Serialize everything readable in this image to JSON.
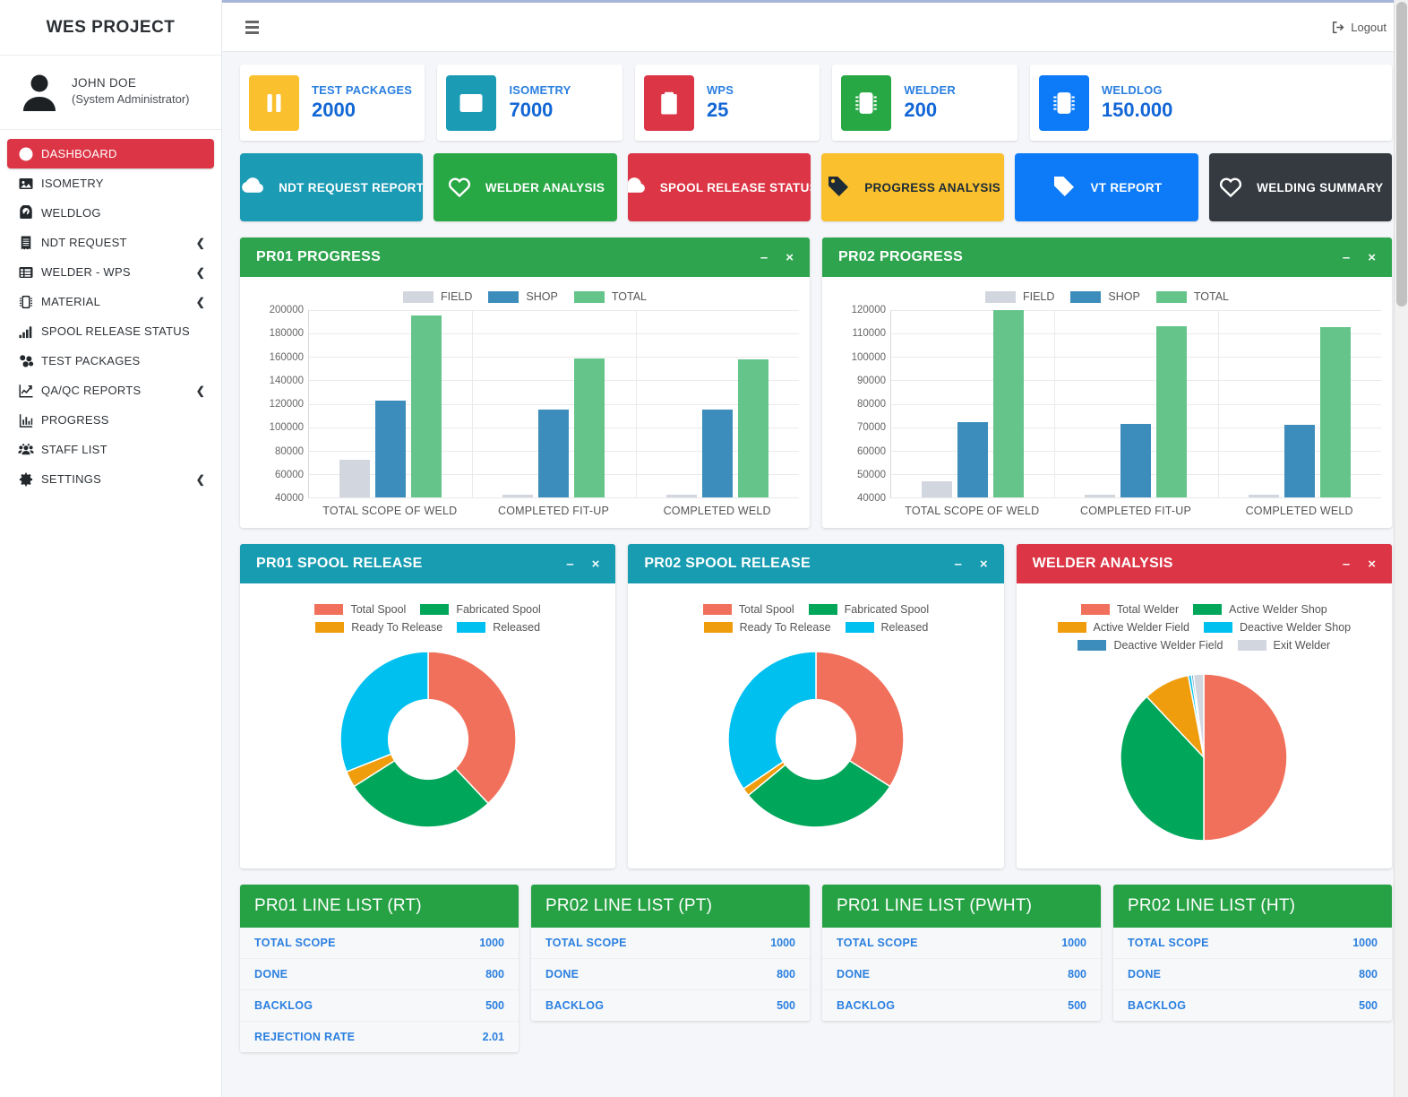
{
  "sidebar": {
    "brand": "WES PROJECT",
    "user": {
      "name": "JOHN DOE",
      "role": "(System Administrator)",
      "avatar_icon": "user-avatar-icon"
    },
    "items": [
      {
        "label": "DASHBOARD",
        "icon": "dashboard-gauge-icon",
        "active": true,
        "chevron": ""
      },
      {
        "label": "ISOMETRY",
        "icon": "image-icon",
        "active": false,
        "chevron": ""
      },
      {
        "label": "WELDLOG",
        "icon": "compass-icon",
        "active": false,
        "chevron": ""
      },
      {
        "label": "NDT REQUEST",
        "icon": "receipt-icon",
        "active": false,
        "chevron": "❮"
      },
      {
        "label": "WELDER - WPS",
        "icon": "table-list-icon",
        "active": false,
        "chevron": "❮"
      },
      {
        "label": "MATERIAL",
        "icon": "chip-icon",
        "active": false,
        "chevron": "❮"
      },
      {
        "label": "SPOOL RELEASE STATUS",
        "icon": "bar-chart-icon",
        "active": false,
        "chevron": ""
      },
      {
        "label": "TEST PACKAGES",
        "icon": "boxes-icon",
        "active": false,
        "chevron": ""
      },
      {
        "label": "QA/QC REPORTS",
        "icon": "line-chart-icon",
        "active": false,
        "chevron": "❮"
      },
      {
        "label": "PROGRESS",
        "icon": "chart-bars-icon",
        "active": false,
        "chevron": ""
      },
      {
        "label": "STAFF LIST",
        "icon": "users-icon",
        "active": false,
        "chevron": ""
      },
      {
        "label": "SETTINGS",
        "icon": "gear-icon",
        "active": false,
        "chevron": "❮"
      }
    ]
  },
  "topbar": {
    "menu_icon": "hamburger-icon",
    "logout_label": "Logout",
    "logout_icon": "logout-icon"
  },
  "stats": [
    {
      "label": "TEST PACKAGES",
      "value": "2000",
      "color": "#FBC02D",
      "icon": "pause-bars-icon"
    },
    {
      "label": "ISOMETRY",
      "value": "7000",
      "color": "#1C9BB5",
      "icon": "image-icon"
    },
    {
      "label": "WPS",
      "value": "25",
      "color": "#DC3545",
      "icon": "clipboard-icon"
    },
    {
      "label": "WELDER",
      "value": "200",
      "color": "#28A745",
      "icon": "chip-icon"
    },
    {
      "label": "WELDLOG",
      "value": "150.000",
      "color": "#0D7BF7",
      "icon": "chip-icon"
    }
  ],
  "actions": [
    {
      "label": "NDT REQUEST REPORT",
      "color": "#1C9BB5",
      "icon": "cloud-download-icon",
      "text_color": "#ffffff"
    },
    {
      "label": "WELDER ANALYSIS",
      "color": "#28A745",
      "icon": "heart-icon",
      "text_color": "#ffffff"
    },
    {
      "label": "SPOOL RELEASE STATUS",
      "color": "#DC3545",
      "icon": "cloud-download-icon",
      "text_color": "#ffffff"
    },
    {
      "label": "PROGRESS ANALYSIS",
      "color": "#FBC02D",
      "icon": "tag-icon",
      "text_color": "#1C2B36"
    },
    {
      "label": "VT REPORT",
      "color": "#0D7BF7",
      "icon": "tag-icon",
      "text_color": "#ffffff"
    },
    {
      "label": "WELDING SUMMARY",
      "color": "#343A40",
      "icon": "heart-icon",
      "text_color": "#ffffff"
    }
  ],
  "panels": {
    "pr01_progress": {
      "title": "PR01 PROGRESS",
      "header_color": "#2EA44F",
      "minimize": "–",
      "close": "×"
    },
    "pr02_progress": {
      "title": "PR02 PROGRESS",
      "header_color": "#2EA44F",
      "minimize": "–",
      "close": "×"
    },
    "pr01_spool": {
      "title": "PR01 SPOOL RELEASE",
      "header_color": "#189CB2",
      "minimize": "–",
      "close": "×"
    },
    "pr02_spool": {
      "title": "PR02 SPOOL RELEASE",
      "header_color": "#189CB2",
      "minimize": "–",
      "close": "×"
    },
    "welder": {
      "title": "WELDER ANALYSIS",
      "header_color": "#DC3545",
      "minimize": "–",
      "close": "×"
    }
  },
  "chart_data": [
    {
      "id": "pr01_progress",
      "type": "bar",
      "title": "PR01 PROGRESS",
      "categories": [
        "TOTAL SCOPE OF WELD",
        "COMPLETED FIT-UP",
        "COMPLETED WELD"
      ],
      "series": [
        {
          "name": "FIELD",
          "color": "#D2D6DE",
          "values": [
            72000,
            42500,
            42000
          ]
        },
        {
          "name": "SHOP",
          "color": "#3C8DBC",
          "values": [
            122000,
            115000,
            114800
          ]
        },
        {
          "name": "TOTAL",
          "color": "#64C48A",
          "values": [
            194500,
            158000,
            157500
          ]
        }
      ],
      "ylim": [
        40000,
        200000
      ],
      "yticks": [
        200000,
        180000,
        160000,
        140000,
        120000,
        100000,
        80000,
        60000,
        40000
      ],
      "xlabel": "",
      "ylabel": "",
      "grid": true,
      "legend_position": "top"
    },
    {
      "id": "pr02_progress",
      "type": "bar",
      "title": "PR02 PROGRESS",
      "categories": [
        "TOTAL SCOPE OF WELD",
        "COMPLETED FIT-UP",
        "COMPLETED WELD"
      ],
      "series": [
        {
          "name": "FIELD",
          "color": "#D2D6DE",
          "values": [
            47000,
            41000,
            41000
          ]
        },
        {
          "name": "SHOP",
          "color": "#3C8DBC",
          "values": [
            72000,
            71300,
            71000
          ]
        },
        {
          "name": "TOTAL",
          "color": "#64C48A",
          "values": [
            119500,
            112800,
            112500
          ]
        }
      ],
      "ylim": [
        40000,
        120000
      ],
      "yticks": [
        120000,
        110000,
        100000,
        90000,
        80000,
        70000,
        60000,
        50000,
        40000
      ],
      "xlabel": "",
      "ylabel": "",
      "grid": true,
      "legend_position": "top"
    },
    {
      "id": "pr01_spool",
      "type": "pie",
      "title": "PR01 SPOOL RELEASE",
      "donut": true,
      "labels": [
        "Total Spool",
        "Fabricated Spool",
        "Ready To Release",
        "Released"
      ],
      "colors": [
        "#F1705B",
        "#00A65A",
        "#EF9C0D",
        "#00C0EF"
      ],
      "values": [
        38,
        28,
        3,
        31
      ],
      "legend_position": "top"
    },
    {
      "id": "pr02_spool",
      "type": "pie",
      "title": "PR02 SPOOL RELEASE",
      "donut": true,
      "labels": [
        "Total Spool",
        "Fabricated Spool",
        "Ready To Release",
        "Released"
      ],
      "colors": [
        "#F1705B",
        "#00A65A",
        "#EF9C0D",
        "#00C0EF"
      ],
      "values": [
        34,
        30,
        1.5,
        34.5
      ],
      "legend_position": "top"
    },
    {
      "id": "welder_analysis",
      "type": "pie",
      "title": "WELDER ANALYSIS",
      "donut": false,
      "labels": [
        "Total Welder",
        "Active Welder Shop",
        "Active Welder Field",
        "Deactive Welder Shop",
        "Deactive Welder Field",
        "Exit Welder"
      ],
      "colors": [
        "#F1705B",
        "#00A65A",
        "#EF9C0D",
        "#00C0EF",
        "#3C8DBC",
        "#D2D6DE"
      ],
      "values": [
        50,
        38,
        9,
        0.6,
        0.4,
        2
      ],
      "legend_position": "top"
    }
  ],
  "line_lists": [
    {
      "title": "PR01 LINE LIST (RT)",
      "header_color": "#26A244",
      "rows": [
        {
          "key": "TOTAL SCOPE",
          "value": "1000"
        },
        {
          "key": "DONE",
          "value": "800"
        },
        {
          "key": "BACKLOG",
          "value": "500"
        },
        {
          "key": "REJECTION RATE",
          "value": "2.01"
        }
      ]
    },
    {
      "title": "PR02 LINE LIST (PT)",
      "header_color": "#26A244",
      "rows": [
        {
          "key": "TOTAL SCOPE",
          "value": "1000"
        },
        {
          "key": "DONE",
          "value": "800"
        },
        {
          "key": "BACKLOG",
          "value": "500"
        }
      ]
    },
    {
      "title": "PR01 LINE LIST (PWHT)",
      "header_color": "#26A244",
      "rows": [
        {
          "key": "TOTAL SCOPE",
          "value": "1000"
        },
        {
          "key": "DONE",
          "value": "800"
        },
        {
          "key": "BACKLOG",
          "value": "500"
        }
      ]
    },
    {
      "title": "PR02 LINE LIST (HT)",
      "header_color": "#26A244",
      "rows": [
        {
          "key": "TOTAL SCOPE",
          "value": "1000"
        },
        {
          "key": "DONE",
          "value": "800"
        },
        {
          "key": "BACKLOG",
          "value": "500"
        }
      ]
    }
  ]
}
